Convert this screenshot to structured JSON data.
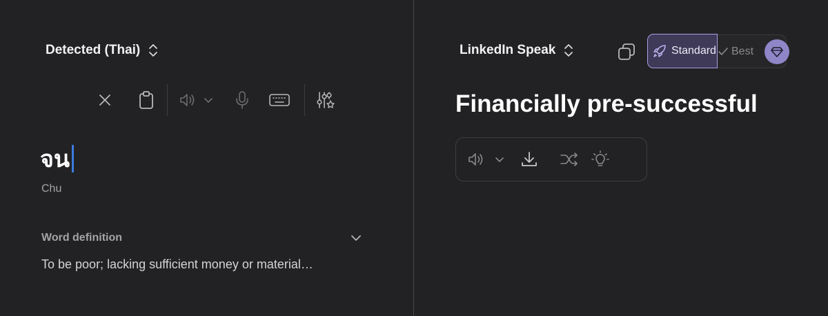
{
  "source": {
    "language_selector_label": "Detected (Thai)",
    "text": "จน",
    "transliteration": "Chu",
    "definition_title": "Word definition",
    "definition_text": "To be poor; lacking sufficient money or material…"
  },
  "source_toolbar": {
    "icons": [
      "close-icon",
      "clipboard-icon",
      "speaker-icon",
      "chevron-down-icon",
      "microphone-icon",
      "keyboard-icon",
      "sliders-sparkle-icon"
    ]
  },
  "target": {
    "language_selector_label": "LinkedIn Speak",
    "translation_text": "Financially pre-successful",
    "modes": {
      "standard_label": "Standard",
      "best_label": "Best"
    },
    "icons": [
      "copy-icon",
      "rocket-icon",
      "check-icon",
      "diamond-icon",
      "speaker-icon",
      "chevron-down-icon",
      "download-icon",
      "shuffle-icon",
      "lightbulb-icon"
    ]
  },
  "colors": {
    "background": "#222224",
    "accent": "#8f86c8",
    "caret": "#3d7be0"
  }
}
